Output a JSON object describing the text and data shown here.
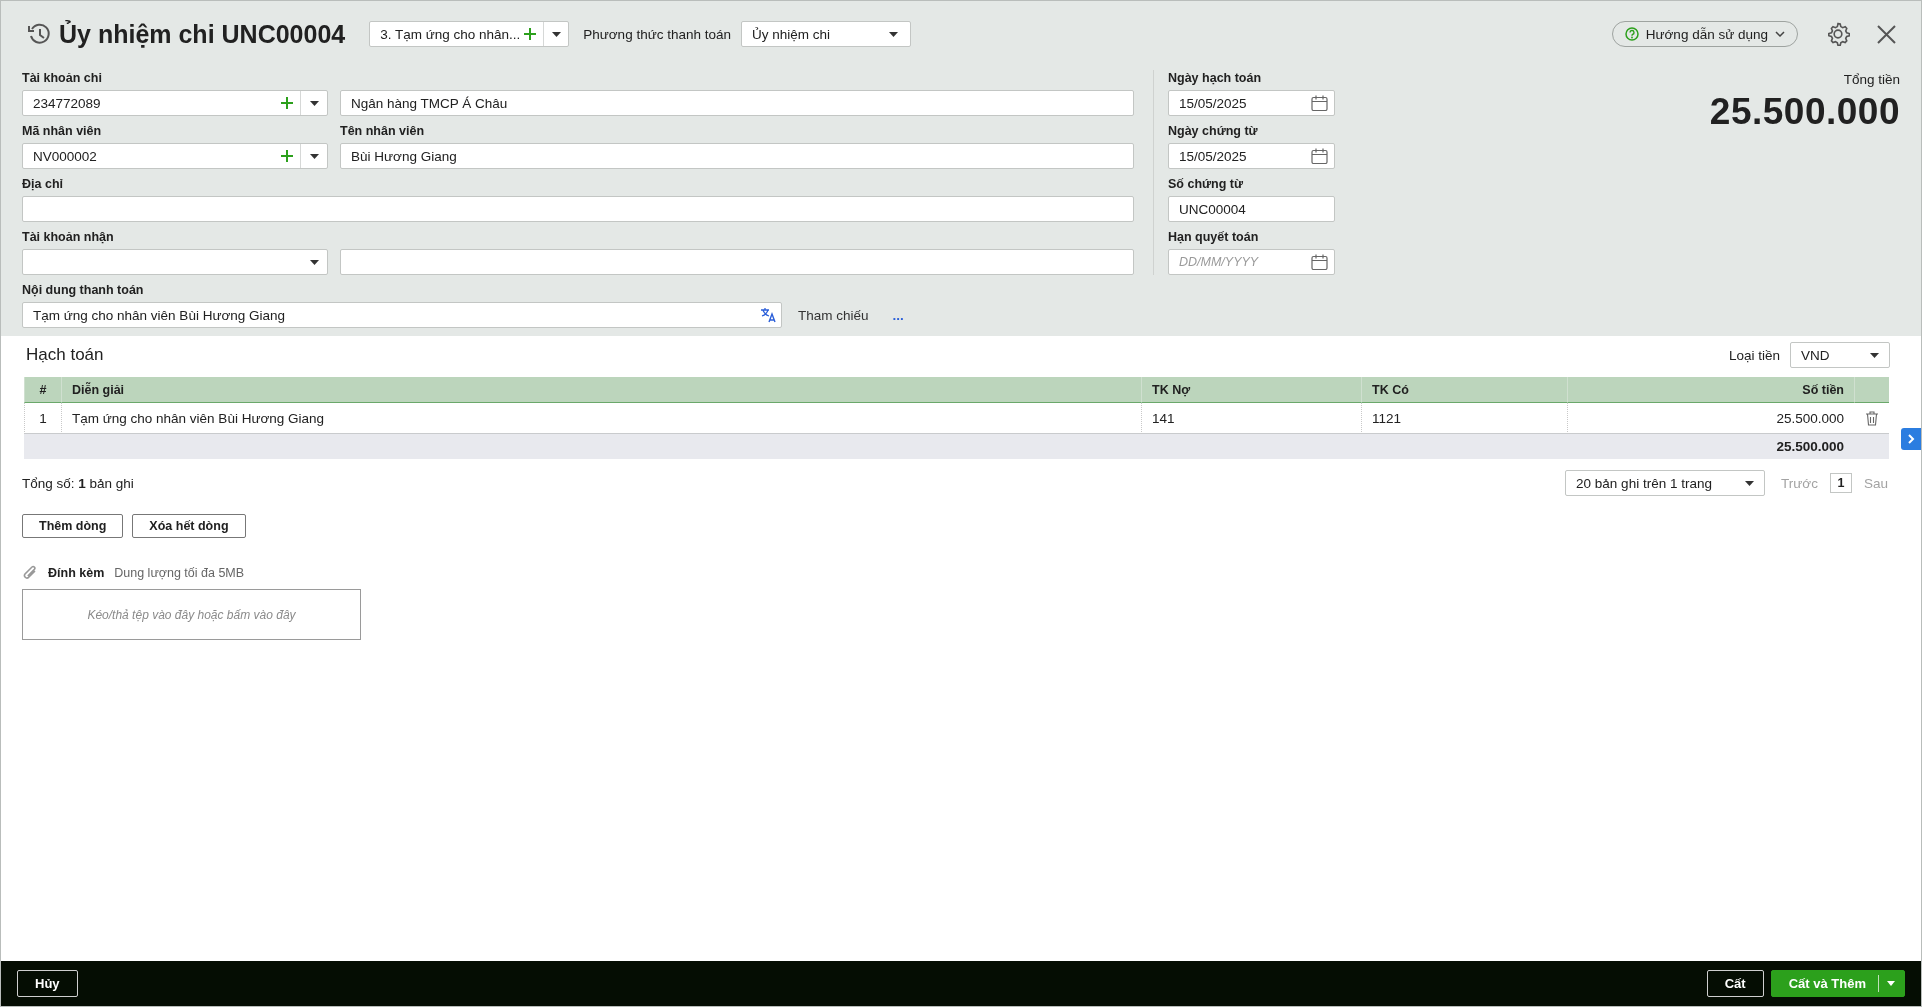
{
  "header": {
    "title": "Ủy nhiệm chi UNC00004",
    "purpose": "3. Tạm ứng cho nhân...",
    "payment_method_label": "Phương thức thanh toán",
    "payment_method": "Ủy nhiệm chi",
    "help": "Hướng dẫn sử dụng"
  },
  "form_rows": [
    {
      "fields": [
        {
          "label": "Tài khoản chi",
          "kind": "combo",
          "value": "234772089"
        },
        {
          "kind": "text",
          "value": "Ngân hàng TMCP Á Châu"
        }
      ]
    },
    {
      "fields": [
        {
          "label": "Mã nhân viên",
          "kind": "combo",
          "value": "NV000002"
        },
        {
          "label": "Tên nhân viên",
          "kind": "text",
          "value": "Bùi Hương Giang"
        }
      ]
    },
    {
      "fields": [
        {
          "label": "Địa chỉ",
          "kind": "wide"
        }
      ]
    },
    {
      "fields": [
        {
          "label": "Tài khoản nhận",
          "kind": "select"
        },
        {
          "kind": "text"
        }
      ]
    },
    {
      "fields": [
        {
          "label": "Nội dung thanh toán",
          "kind": "translate",
          "value": "Tạm ứng cho nhân viên Bùi Hương Giang"
        },
        {
          "kind": "link",
          "value": "Tham chiếu"
        },
        {
          "kind": "more",
          "value": "..."
        }
      ]
    }
  ],
  "voucher_fields": [
    {
      "label": "Ngày hạch toán",
      "kind": "date",
      "value": "15/05/2025"
    },
    {
      "label": "Ngày chứng từ",
      "kind": "date",
      "value": "15/05/2025"
    },
    {
      "label": "Số chứng từ",
      "kind": "text",
      "value": "UNC00004"
    },
    {
      "label": "Hạn quyết toán",
      "kind": "date",
      "placeholder": "DD/MM/YYYY"
    }
  ],
  "total": {
    "label": "Tổng tiền",
    "amount": "25.500.000"
  },
  "accounting": {
    "title": "Hạch toán",
    "currency_label": "Loại tiền",
    "currency": "VND",
    "columns": [
      "#",
      "Diễn giải",
      "TK Nợ",
      "TK Có",
      "Số tiền"
    ],
    "rows": [
      {
        "cells": [
          "1",
          "Tạm ứng cho nhân viên Bùi Hương Giang",
          "141",
          "1121",
          "25.500.000"
        ]
      }
    ],
    "total": "25.500.000",
    "record_count": "Tổng số: **1** bản ghi",
    "page_size": "20 bản ghi trên 1 trang",
    "prev": {
      "label": "Trước",
      "disabled": true
    },
    "page": "1",
    "next": {
      "label": "Sau",
      "disabled": true
    }
  },
  "row_buttons": [
    "Thêm dòng",
    "Xóa hết dòng"
  ],
  "attachment": {
    "label": "Đính kèm",
    "limit": "Dung lượng tối đa 5MB",
    "dropzone": "Kéo/thả tệp vào đây hoặc bấm vào đây"
  },
  "footer": {
    "cancel": "Hủy",
    "save": "Cất",
    "save_add": "Cất và Thêm"
  }
}
